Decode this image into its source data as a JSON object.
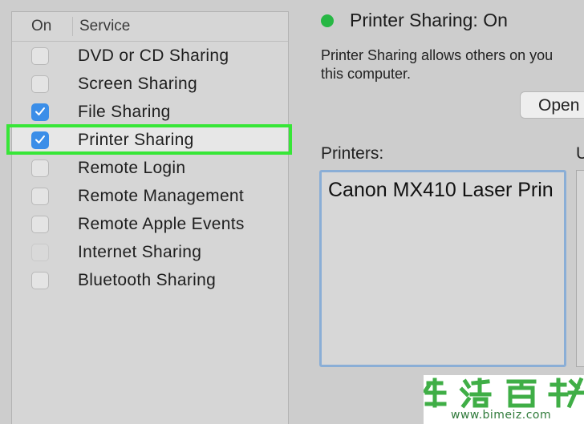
{
  "services": {
    "header": {
      "on": "On",
      "service": "Service"
    },
    "items": [
      {
        "label": "DVD or CD Sharing",
        "checked": false,
        "enabled": true
      },
      {
        "label": "Screen Sharing",
        "checked": false,
        "enabled": true
      },
      {
        "label": "File Sharing",
        "checked": true,
        "enabled": true
      },
      {
        "label": "Printer Sharing",
        "checked": true,
        "enabled": true,
        "selected": true
      },
      {
        "label": "Remote Login",
        "checked": false,
        "enabled": true
      },
      {
        "label": "Remote Management",
        "checked": false,
        "enabled": true
      },
      {
        "label": "Remote Apple Events",
        "checked": false,
        "enabled": true
      },
      {
        "label": "Internet Sharing",
        "checked": false,
        "enabled": false
      },
      {
        "label": "Bluetooth Sharing",
        "checked": false,
        "enabled": true
      }
    ]
  },
  "status": {
    "text": "Printer Sharing: On",
    "dot_color": "#27b744"
  },
  "description": {
    "line1": "Printer Sharing allows others on you",
    "line2": "this computer."
  },
  "open_button": {
    "label": "Open"
  },
  "printers": {
    "label": "Printers:",
    "items": [
      "Canon MX410 Laser Prin"
    ]
  },
  "users": {
    "label": "U"
  },
  "colors": {
    "accent": "#3b8ee8",
    "highlight": "#37e637",
    "status_on": "#27b744"
  },
  "watermark": {
    "url": "www.bimeiz.com"
  }
}
